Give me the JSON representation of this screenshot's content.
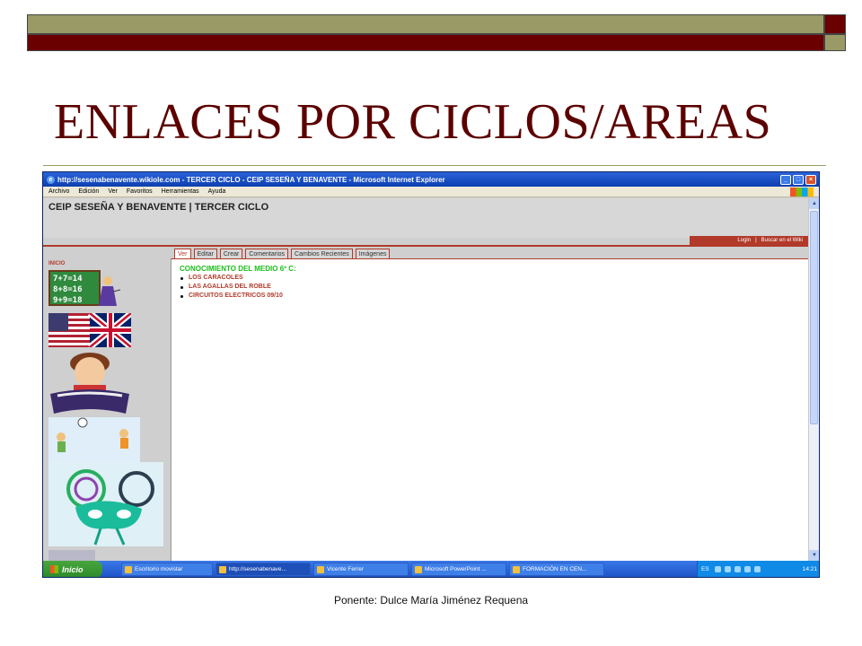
{
  "slide": {
    "title": "ENLACES POR CICLOS/AREAS",
    "footer": "Ponente: Dulce María Jiménez Requena",
    "colors": {
      "olive": "#9a9a66",
      "maroon": "#6b0000",
      "title": "#5c0000"
    }
  },
  "browser": {
    "window_title": "http://sesenabenavente.wikiole.com - TERCER CICLO - CEIP SESEÑA Y BENAVENTE - Microsoft Internet Explorer",
    "menu": [
      "Archivo",
      "Edición",
      "Ver",
      "Favoritos",
      "Herramientas",
      "Ayuda"
    ],
    "window_buttons": {
      "minimize": "_",
      "maximize": "□",
      "close": "×"
    }
  },
  "wiki": {
    "site_title": "CEIP SESEÑA Y BENAVENTE | TERCER CICLO",
    "top_nav": [
      "Login",
      "|",
      "Buscar en el Wiki"
    ],
    "sidebar_label": "INICIO",
    "tabs": [
      "Ver",
      "Editar",
      "Crear",
      "Comentarios",
      "Cambios Recientes",
      "Imágenes"
    ],
    "active_tab": "Ver",
    "heading": "CONOCIMIENTO DEL MEDIO 6º C:",
    "links": [
      "LOS CARACOLES",
      "LAS AGALLAS DEL ROBLE",
      "CIRCUITOS ELECTRICOS 09/10"
    ],
    "colors": {
      "accent": "#b13a2a",
      "heading_green": "#1bbf1b"
    }
  },
  "scrollbar": {
    "up": "▲",
    "down": "▼"
  },
  "taskbar": {
    "start_label": "Inicio",
    "tasks": [
      "Escritorio movistar",
      "http://sesenabenave...",
      "Vicente Ferrer",
      "Microsoft PowerPoint ...",
      "FORMACIÓN EN CEN..."
    ],
    "tray_lang": "ES",
    "clock": "14:21"
  }
}
